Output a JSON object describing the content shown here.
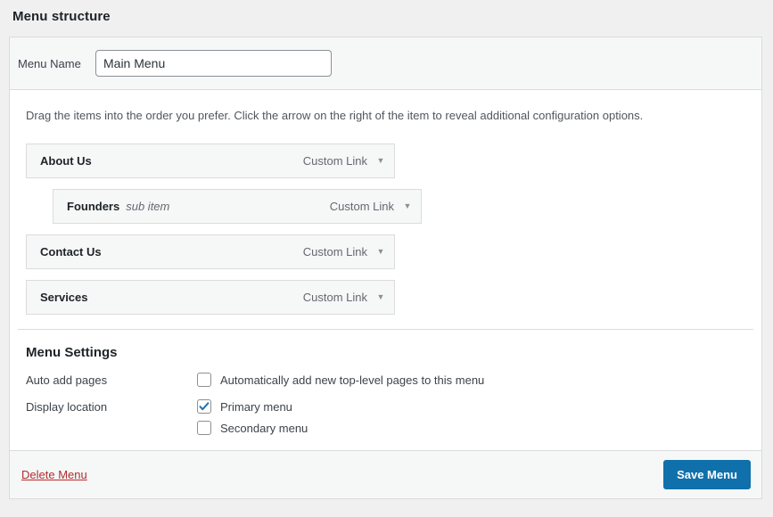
{
  "page": {
    "title": "Menu structure"
  },
  "menu_name": {
    "label": "Menu Name",
    "value": "Main Menu",
    "placeholder": "Menu Name"
  },
  "drag_hint": "Drag the items into the order you prefer. Click the arrow on the right of the item to reveal additional configuration options.",
  "menu_items": [
    {
      "title": "About Us",
      "sub_label": "",
      "type": "Custom Link",
      "depth": 0,
      "arrow": "▼"
    },
    {
      "title": "Founders",
      "sub_label": "sub item",
      "type": "Custom Link",
      "depth": 1,
      "arrow": "▼"
    },
    {
      "title": "Contact Us",
      "sub_label": "",
      "type": "Custom Link",
      "depth": 0,
      "arrow": "▼"
    },
    {
      "title": "Services",
      "sub_label": "",
      "type": "Custom Link",
      "depth": 0,
      "arrow": "▼"
    }
  ],
  "settings": {
    "title": "Menu Settings",
    "auto_add": {
      "label": "Auto add pages",
      "option_label": "Automatically add new top-level pages to this menu",
      "checked": false
    },
    "display_location": {
      "label": "Display location",
      "options": [
        {
          "label": "Primary menu",
          "checked": true
        },
        {
          "label": "Secondary menu",
          "checked": false
        }
      ]
    }
  },
  "footer": {
    "delete_label": "Delete Menu",
    "save_label": "Save Menu"
  },
  "colors": {
    "accent": "#1070ab",
    "danger": "#b32d2e",
    "panel_bg": "#ffffff",
    "page_bg": "#f0f0f1",
    "row_bg": "#f6f7f7",
    "border": "#dcdcde"
  }
}
